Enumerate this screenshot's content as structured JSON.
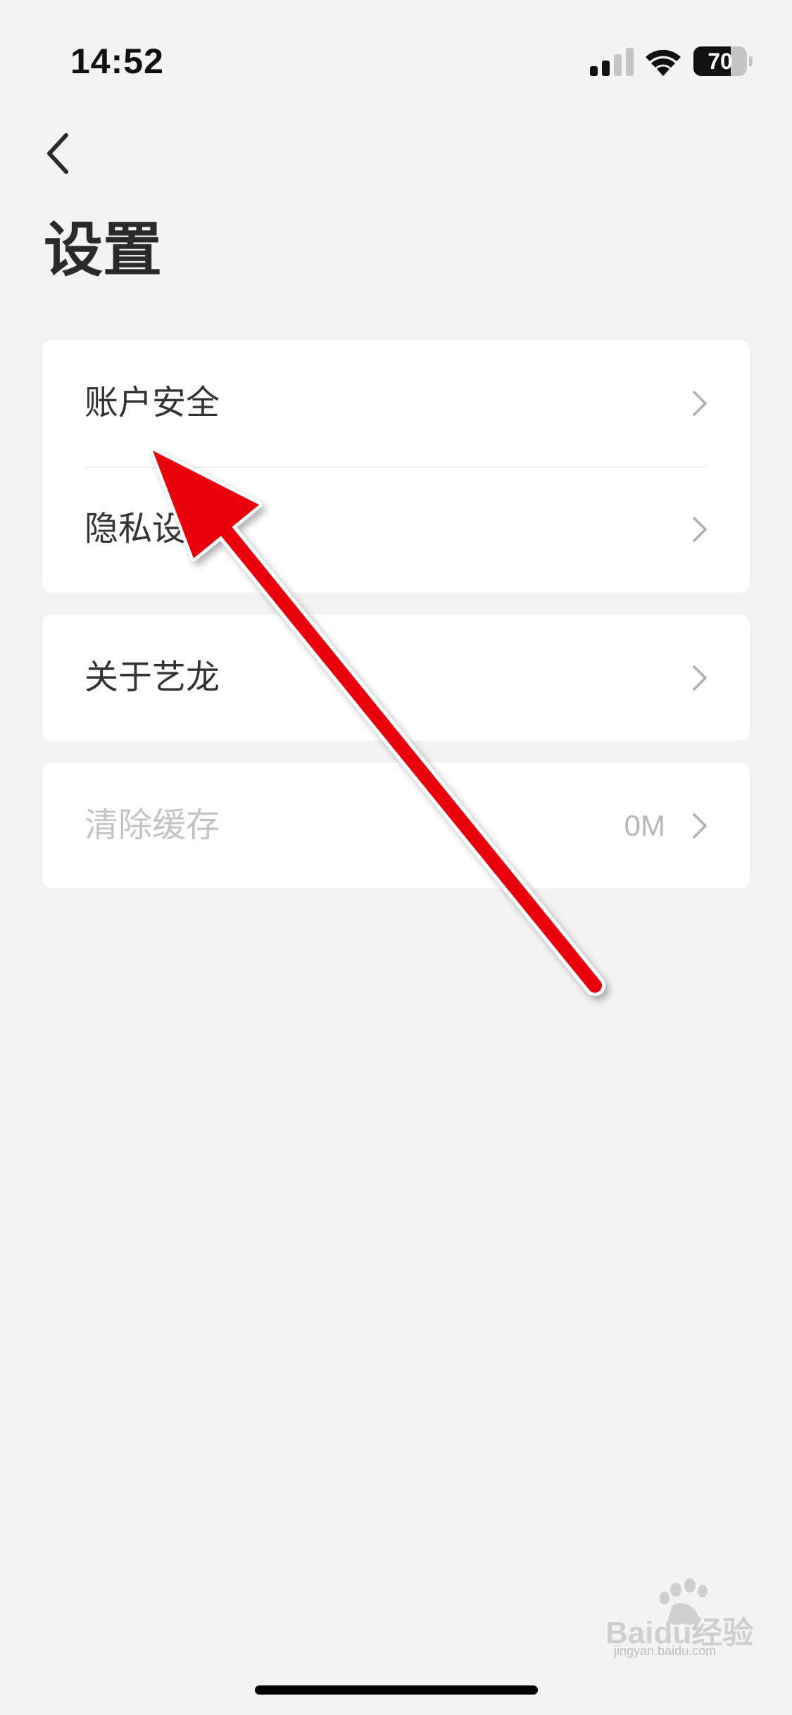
{
  "status_bar": {
    "time": "14:52",
    "battery_level": "70",
    "battery_fraction": 0.7,
    "icons": [
      "signal-icon",
      "wifi-icon",
      "battery-icon"
    ]
  },
  "header": {
    "back_icon": "chevron-left-icon",
    "title": "设置"
  },
  "settings": {
    "group1": [
      {
        "label": "账户安全",
        "icon": "chevron-right-icon"
      },
      {
        "label": "隐私设置",
        "icon": "chevron-right-icon"
      }
    ],
    "group2": [
      {
        "label": "关于艺龙",
        "icon": "chevron-right-icon"
      }
    ],
    "group3": [
      {
        "label": "清除缓存",
        "value": "0M",
        "icon": "chevron-right-icon",
        "disabled": true
      }
    ]
  },
  "annotation": {
    "type": "red-arrow",
    "color": "#e8000b",
    "points_to": "账户安全"
  },
  "watermark": {
    "text": "Baidu经验",
    "subtext": "jingyan.baidu.com"
  },
  "colors": {
    "background": "#f3f3f3",
    "card": "#ffffff",
    "disabled_text": "#c4c4c4"
  }
}
